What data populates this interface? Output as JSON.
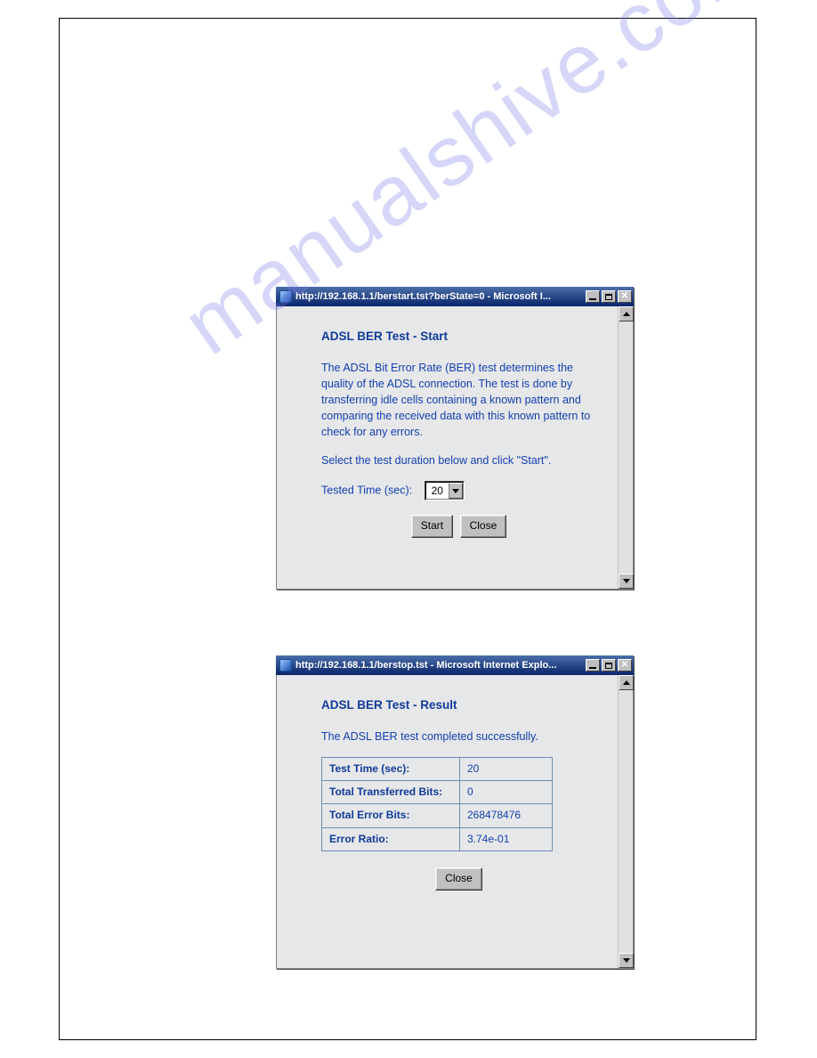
{
  "watermark": "manualshive.com",
  "window1": {
    "title": "http://192.168.1.1/berstart.tst?berState=0 - Microsoft I...",
    "heading": "ADSL BER Test - Start",
    "description": "The ADSL Bit Error Rate (BER) test determines the quality of the ADSL connection. The test is done by transferring idle cells containing a known pattern and comparing the received data with this known pattern to check for any errors.",
    "instruction": "Select the test duration below and click \"Start\".",
    "tested_time_label": "Tested Time (sec):",
    "tested_time_value": "20",
    "start_label": "Start",
    "close_label": "Close"
  },
  "window2": {
    "title": "http://192.168.1.1/berstop.tst - Microsoft Internet Explo...",
    "heading": "ADSL BER Test - Result",
    "description": "The ADSL BER test completed successfully.",
    "rows": {
      "0": {
        "k": "Test Time (sec):",
        "v": "20"
      },
      "1": {
        "k": "Total Transferred Bits:",
        "v": "0"
      },
      "2": {
        "k": "Total Error Bits:",
        "v": "268478476"
      },
      "3": {
        "k": "Error Ratio:",
        "v": "3.74e-01"
      }
    },
    "close_label": "Close"
  }
}
